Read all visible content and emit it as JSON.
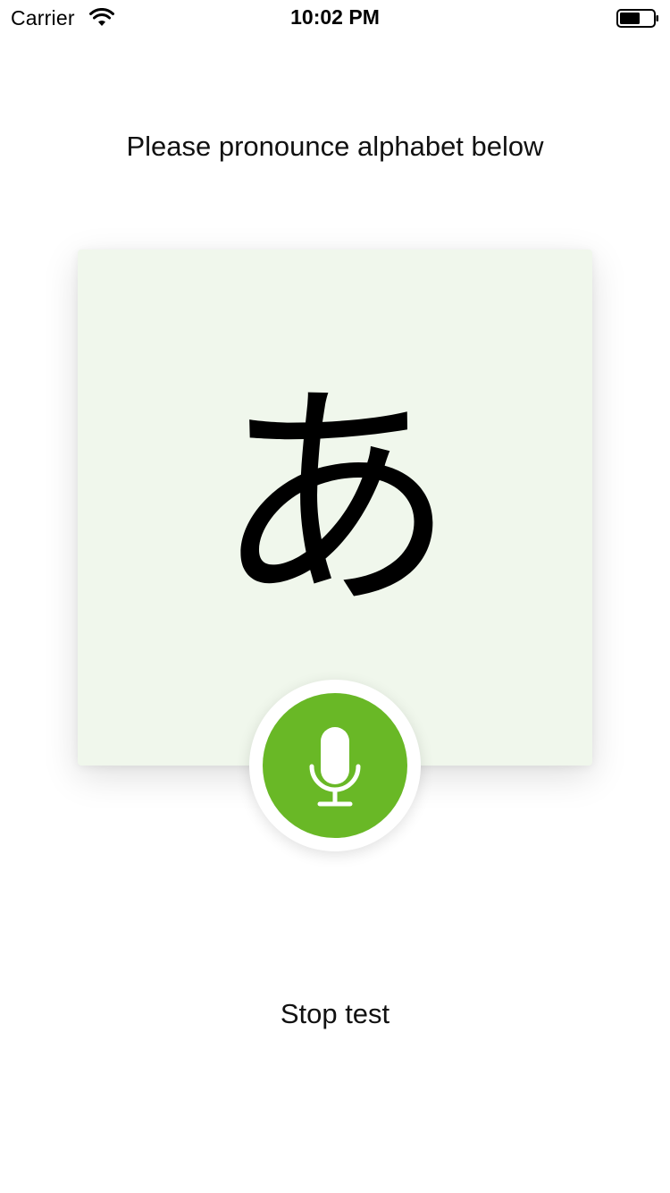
{
  "status_bar": {
    "carrier": "Carrier",
    "time": "10:02 PM",
    "wifi_icon": "wifi-icon",
    "battery_icon": "battery-icon"
  },
  "prompt": "Please pronounce alphabet below",
  "card": {
    "character": "あ",
    "background_color": "#f0f7ec"
  },
  "mic_button": {
    "icon": "microphone-icon",
    "color": "#69b826"
  },
  "stop_button": {
    "label": "Stop test"
  }
}
